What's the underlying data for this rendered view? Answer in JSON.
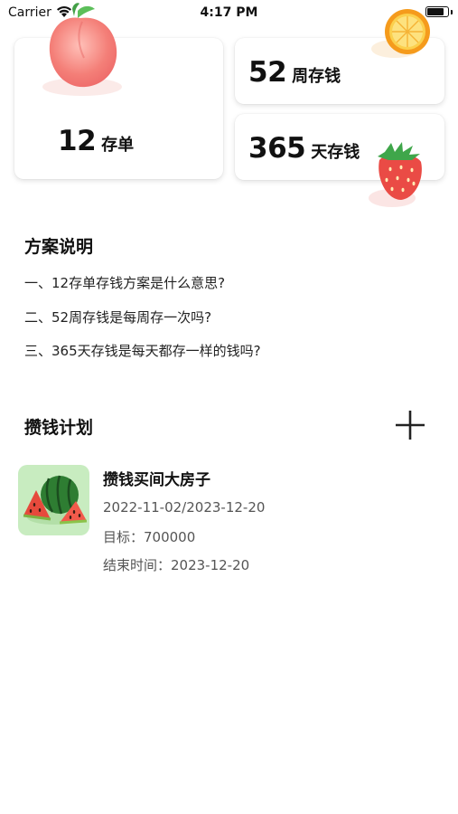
{
  "status_bar": {
    "carrier": "Carrier",
    "time": "4:17 PM"
  },
  "cards": [
    {
      "number": "12",
      "unit": "存单",
      "fruit": "peach-icon"
    },
    {
      "number": "52",
      "unit": "周存钱",
      "fruit": "orange-icon"
    },
    {
      "number": "365",
      "unit": "天存钱",
      "fruit": "strawberry-icon"
    }
  ],
  "scheme": {
    "title": "方案说明",
    "items": [
      "一、12存单存钱方案是什么意思?",
      "二、52周存钱是每周存一次吗?",
      "三、365天存钱是每天都存一样的钱吗?"
    ]
  },
  "plans": {
    "title": "攒钱计划",
    "add_icon": "plus-icon",
    "items": [
      {
        "name": "攒钱买间大房子",
        "dates": "2022-11-02/2023-12-20",
        "target": "目标：700000",
        "end": "结束时间：2023-12-20",
        "icon": "watermelon-icon"
      }
    ]
  }
}
